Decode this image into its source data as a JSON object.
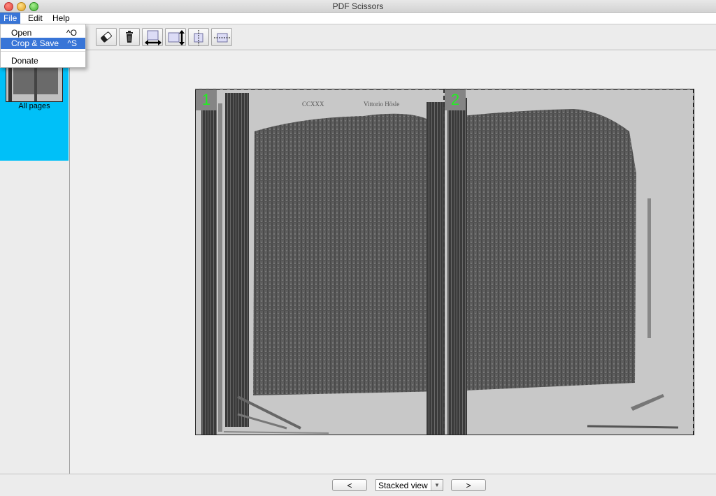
{
  "window": {
    "title": "PDF Scissors"
  },
  "menubar": {
    "items": [
      {
        "label": "File"
      },
      {
        "label": "Edit"
      },
      {
        "label": "Help"
      }
    ]
  },
  "file_menu": {
    "items": [
      {
        "label": "Open",
        "shortcut": "^O"
      },
      {
        "label": "Crop & Save",
        "shortcut": "^S"
      },
      {
        "label": "Donate"
      }
    ]
  },
  "toolbar": {
    "buttons": [
      {
        "icon": "eraser-icon"
      },
      {
        "icon": "trash-icon"
      },
      {
        "icon": "equal-width-icon"
      },
      {
        "icon": "equal-height-icon"
      },
      {
        "icon": "split-vertical-icon"
      },
      {
        "icon": "split-horizontal-icon"
      }
    ]
  },
  "sidebar": {
    "items": [
      {
        "label": "All pages",
        "selected": true
      }
    ]
  },
  "viewer": {
    "pages": [
      {
        "number": "1",
        "header_text": "CCXXX"
      },
      {
        "number": "2",
        "header_text": "Vittorio Hösle"
      }
    ]
  },
  "bottom": {
    "prev_label": "<",
    "next_label": ">",
    "view_mode": "Stacked view"
  },
  "colors": {
    "selection": "#3875d7",
    "thumbnail_highlight": "#00c0f8",
    "page_number": "#22ee22"
  }
}
